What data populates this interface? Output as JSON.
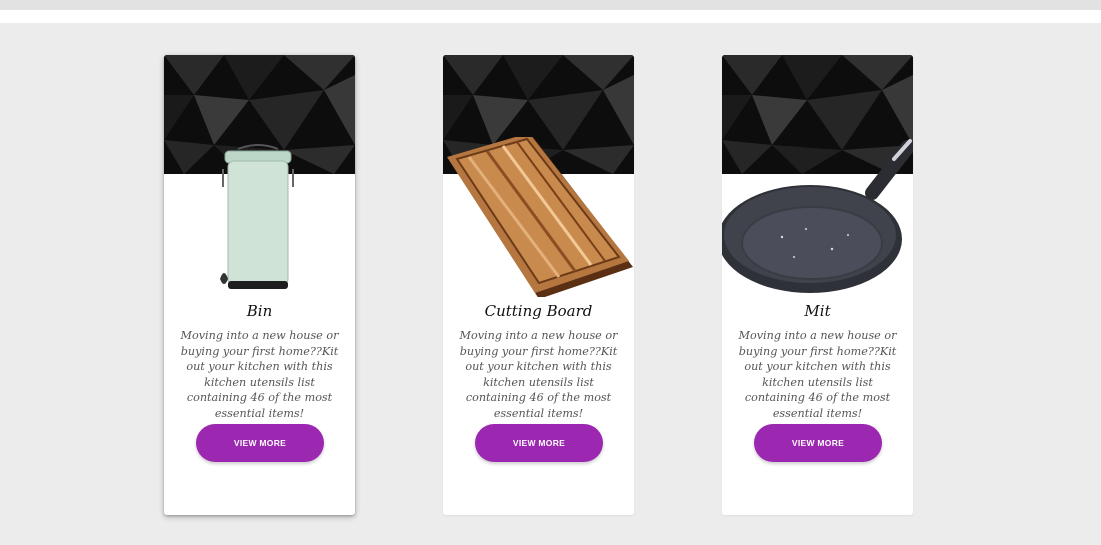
{
  "accent_color": "#9c27b0",
  "cards": [
    {
      "title": "Bin",
      "description": "Moving into a new house or buying your first home??Kit out your kitchen with this kitchen utensils list containing 46 of the most essential items!",
      "button_label": "VIEW MORE",
      "image_icon": "pedal-bin-icon"
    },
    {
      "title": "Cutting Board",
      "description": "Moving into a new house or buying your first home??Kit out your kitchen with this kitchen utensils list containing 46 of the most essential items!",
      "button_label": "VIEW MORE",
      "image_icon": "cutting-board-icon"
    },
    {
      "title": "Mit",
      "description": "Moving into a new house or buying your first home??Kit out your kitchen with this kitchen utensils list containing 46 of the most essential items!",
      "button_label": "VIEW MORE",
      "image_icon": "frying-pan-icon"
    }
  ]
}
